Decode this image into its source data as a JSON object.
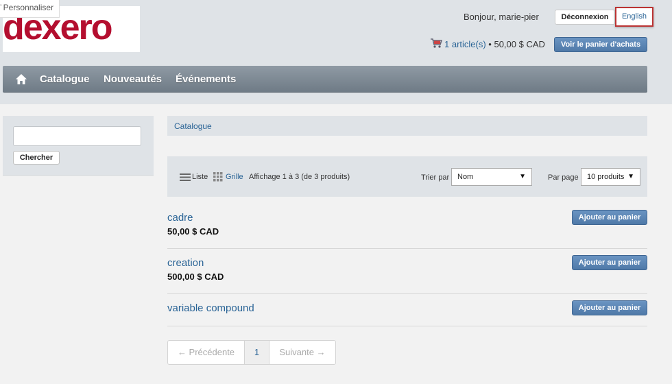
{
  "customize": {
    "label": "Personnaliser"
  },
  "logo": {
    "text": "dexero"
  },
  "header": {
    "greeting": "Bonjour, marie-pier",
    "logout": "Déconnexion",
    "language": "English",
    "cart_link": "1 article(s)",
    "cart_total": " • 50,00 $ CAD",
    "view_cart": "Voir le panier d'achats"
  },
  "nav": {
    "items": [
      {
        "label": "Catalogue"
      },
      {
        "label": "Nouveautés"
      },
      {
        "label": "Événements"
      }
    ]
  },
  "search": {
    "button": "Chercher",
    "value": ""
  },
  "breadcrumb": {
    "current": "Catalogue"
  },
  "toolbar": {
    "list_label": "Liste",
    "grid_label": "Grille",
    "display_count": "Affichage 1 à 3 (de 3 produits)",
    "sort_label": "Trier par",
    "sort_value": "Nom",
    "perpage_label": "Par page",
    "perpage_value": "10 produits"
  },
  "products": [
    {
      "name": "cadre",
      "price": "50,00 $ CAD",
      "add": "Ajouter au panier"
    },
    {
      "name": "creation",
      "price": "500,00 $ CAD",
      "add": "Ajouter au panier"
    },
    {
      "name": "variable compound",
      "price": "",
      "add": "Ajouter au panier"
    }
  ],
  "pagination": {
    "prev": "← Précédente",
    "current": "1",
    "next": "Suivante →"
  },
  "colors": {
    "link": "#2a6496",
    "brand": "#b40e2f",
    "button": "#5a84b4"
  },
  "icons": {
    "home": "home-icon",
    "cart": "cart-icon",
    "list": "list-view-icon",
    "grid": "grid-view-icon"
  }
}
